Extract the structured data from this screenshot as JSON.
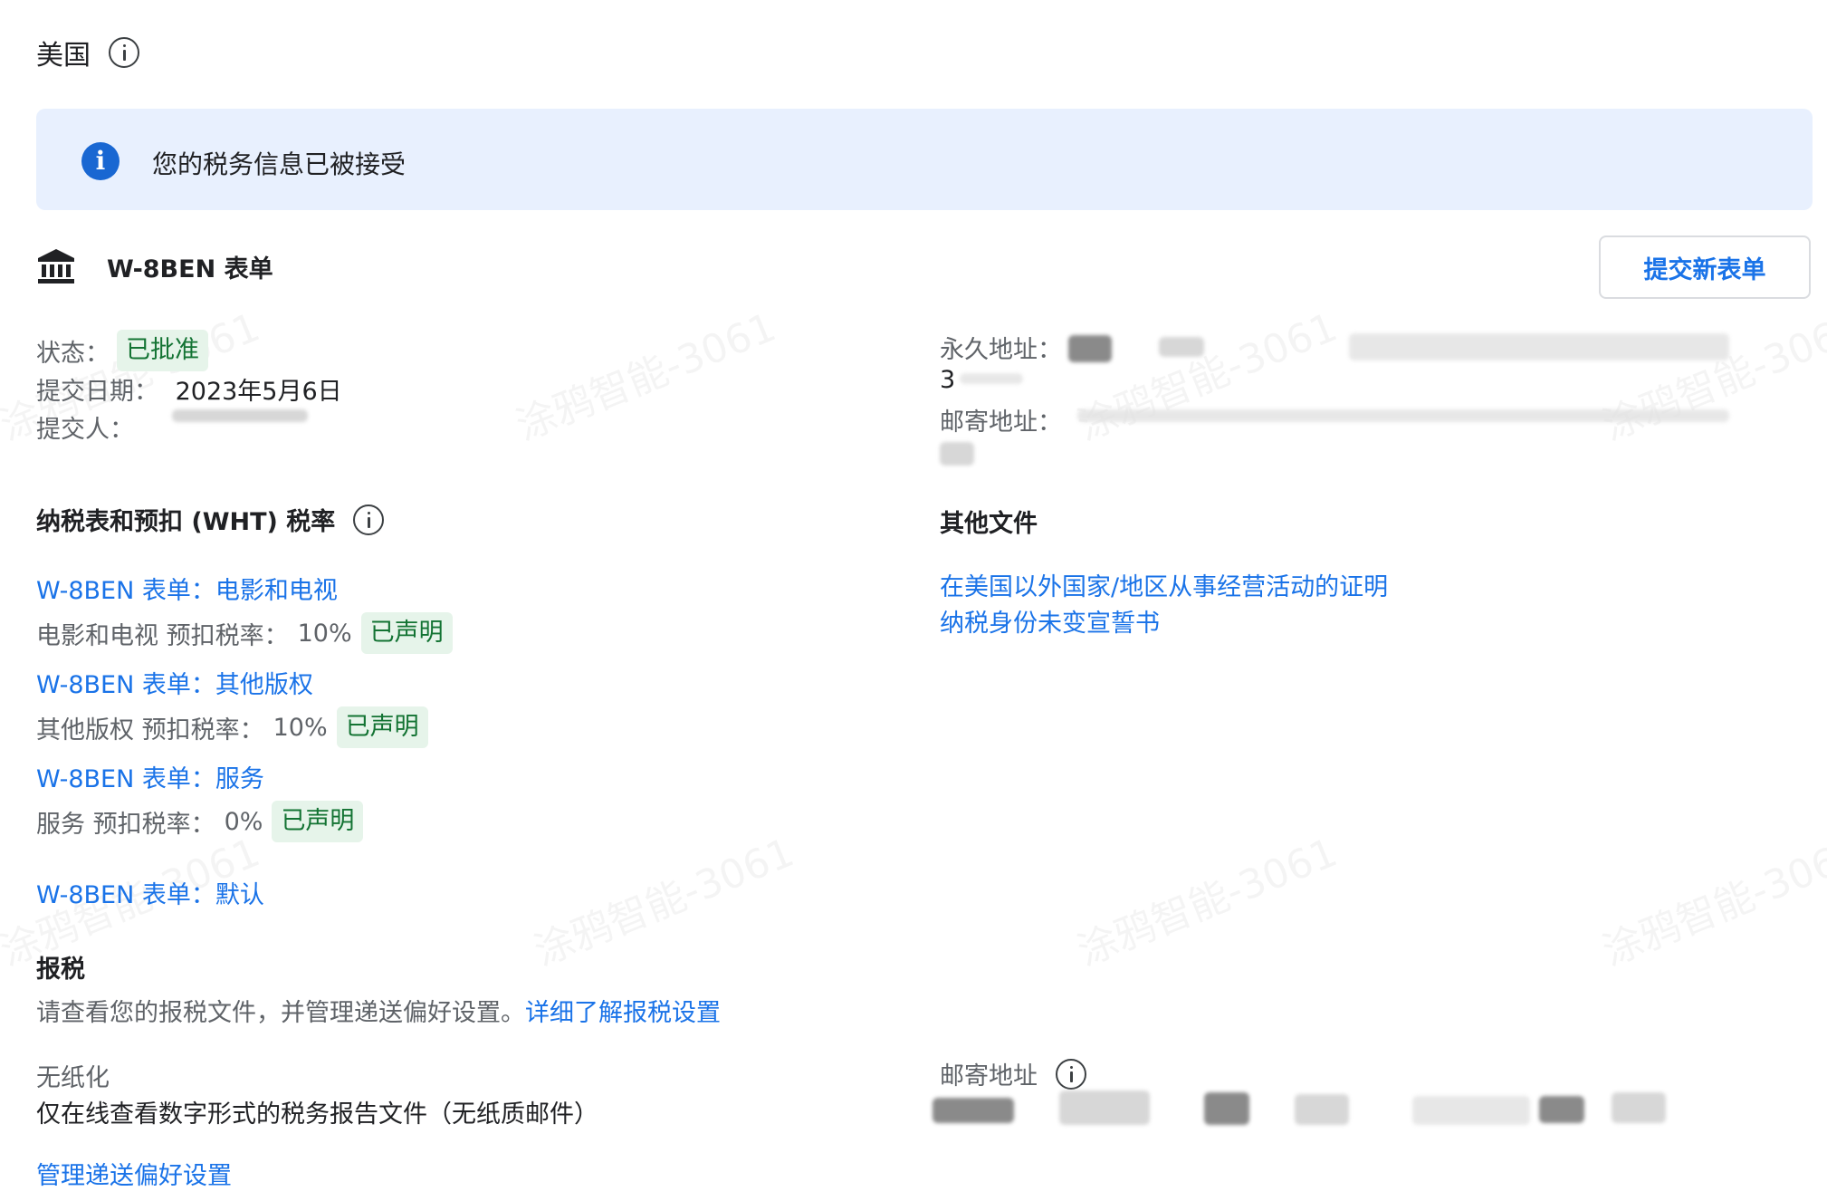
{
  "header": {
    "country": "美国"
  },
  "banner": {
    "text": "您的税务信息已被接受"
  },
  "form": {
    "title": "W-8BEN 表单",
    "submit_new_label": "提交新表单",
    "status_label": "状态：",
    "status_value": "已批准",
    "submit_date_label": "提交日期：",
    "submit_date_value": "2023年5月6日",
    "submitter_label": "提交人：",
    "permanent_address_label": "永久地址：",
    "permanent_address_partial": "3",
    "mailing_address_label": "邮寄地址："
  },
  "wht": {
    "heading": "纳税表和预扣 (WHT) 税率",
    "items": [
      {
        "link": "W-8BEN 表单：电影和电视",
        "rate_label": "电影和电视 预扣税率：",
        "rate_value": "10%",
        "badge": "已声明"
      },
      {
        "link": "W-8BEN 表单：其他版权",
        "rate_label": "其他版权 预扣税率：",
        "rate_value": "10%",
        "badge": "已声明"
      },
      {
        "link": "W-8BEN 表单：服务",
        "rate_label": "服务 预扣税率：",
        "rate_value": "0%",
        "badge": "已声明"
      }
    ],
    "default_link": "W-8BEN 表单：默认"
  },
  "other_docs": {
    "heading": "其他文件",
    "links": [
      "在美国以外国家/地区从事经营活动的证明",
      "纳税身份未变宣誓书"
    ]
  },
  "tax_reporting": {
    "heading": "报税",
    "description": "请查看您的报税文件，并管理递送偏好设置。",
    "learn_more_link": "详细了解报税设置",
    "paperless_label": "无纸化",
    "paperless_description": "仅在线查看数字形式的税务报告文件（无纸质邮件）",
    "manage_link": "管理递送偏好设置",
    "mailing_address_label": "邮寄地址"
  },
  "watermark_text": "涂鸦智能-3061",
  "colors": {
    "link_blue": "#1a73e8",
    "banner_bg": "#e8f0fe",
    "banner_icon": "#1967d2",
    "chip_bg": "#e6f4ea",
    "chip_text": "#137333",
    "muted_text": "#5f6368"
  }
}
